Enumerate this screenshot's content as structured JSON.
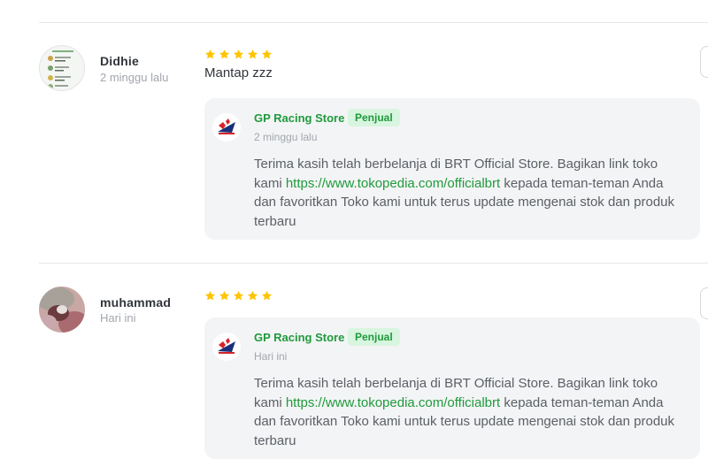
{
  "reviews": [
    {
      "user_name": "Didhie",
      "time": "2 minggu lalu",
      "rating": 5,
      "review_text": "Mantap zzz",
      "reply": {
        "seller_name": "GP Racing Store",
        "badge": "Penjual",
        "time": "2 minggu lalu",
        "text_before": "Terima kasih telah berbelanja di BRT Official Store. Bagikan link toko kami ",
        "link": "https://www.tokopedia.com/officialbrt",
        "text_after": " kepada teman-teman Anda dan favoritkan Toko kami untuk terus update mengenai stok dan produk terbaru"
      }
    },
    {
      "user_name": "muhammad",
      "time": "Hari ini",
      "rating": 5,
      "review_text": "",
      "reply": {
        "seller_name": "GP Racing Store",
        "badge": "Penjual",
        "time": "Hari ini",
        "text_before": "Terima kasih telah berbelanja di BRT Official Store. Bagikan link toko kami ",
        "link": "https://www.tokopedia.com/officialbrt",
        "text_after": " kepada teman-teman Anda dan favoritkan Toko kami untuk terus update mengenai stok dan produk terbaru"
      }
    }
  ],
  "colors": {
    "star": "#ffc400",
    "seller_green": "#1f9a3c",
    "badge_bg": "#d8f5df"
  },
  "icons": {
    "star": "star-icon",
    "seller_logo": "gp-racing-logo"
  }
}
